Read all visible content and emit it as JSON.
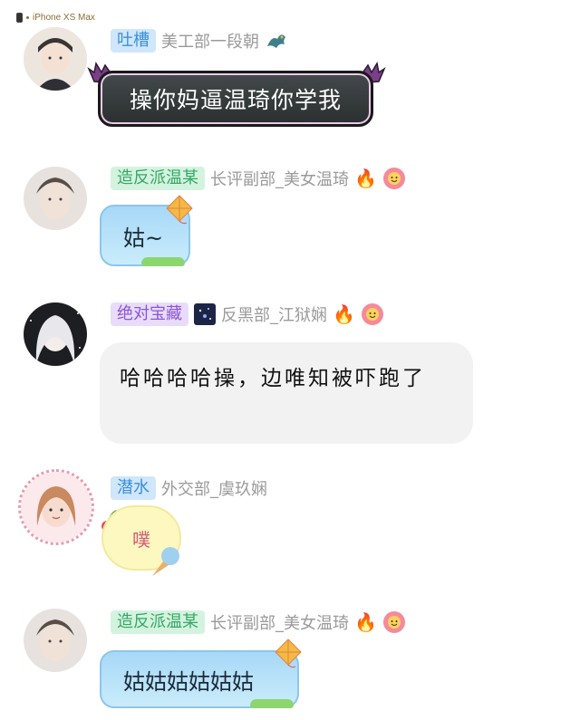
{
  "device_label": "iPhone XS Max",
  "messages": [
    {
      "title": "吐槽",
      "nickname": "美工部一段朝",
      "text": "操你妈逼温琦你学我",
      "icons": [
        "dragon-icon"
      ]
    },
    {
      "title": "造反派温某",
      "nickname": "长评副部_美女温琦",
      "text": "姑~",
      "icons": [
        "fire-icon",
        "flower-face-icon"
      ]
    },
    {
      "title": "绝对宝藏",
      "nickname": "反黑部_江狱娴",
      "text": "哈哈哈哈操，边唯知被吓跑了",
      "icons": [
        "galaxy-icon",
        "bonfire-icon",
        "flower-face-icon"
      ]
    },
    {
      "title": "潜水",
      "nickname": "外交部_虞玖娴",
      "text": "噗",
      "icons": []
    },
    {
      "title": "造反派温某",
      "nickname": "长评副部_美女温琦",
      "text": "姑姑姑姑姑姑",
      "icons": [
        "fire-icon",
        "flower-face-icon"
      ]
    }
  ],
  "colors": {
    "tag_blue": "#3c8fd6",
    "tag_green": "#35a866",
    "tag_purple": "#8a55d6",
    "nick_gray": "#9a9a9a"
  }
}
